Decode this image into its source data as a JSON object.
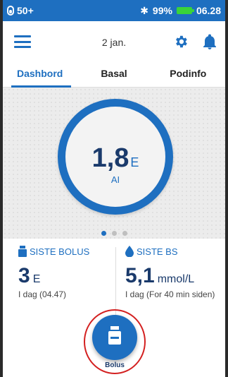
{
  "status_bar": {
    "left_text": "50+",
    "battery_percent": "99%",
    "time": "06.28"
  },
  "top_bar": {
    "date": "2 jan."
  },
  "tabs": [
    {
      "label": "Dashbord",
      "active": true
    },
    {
      "label": "Basal",
      "active": false
    },
    {
      "label": "Podinfo",
      "active": false
    }
  ],
  "iob": {
    "value": "1,8",
    "unit": "E",
    "label": "AI"
  },
  "pager": {
    "count": 3,
    "active_index": 0
  },
  "last_bolus": {
    "title": "SISTE BOLUS",
    "value": "3",
    "unit": "E",
    "time": "I dag (04.47)"
  },
  "last_bg": {
    "title": "SISTE BS",
    "value": "5,1",
    "unit": "mmol/L",
    "time": "I dag (For 40 min siden)"
  },
  "bolus_button": {
    "label": "Bolus"
  },
  "colors": {
    "primary": "#1e6fc0",
    "battery": "#3ad33a",
    "highlight_ring": "#d32020"
  }
}
